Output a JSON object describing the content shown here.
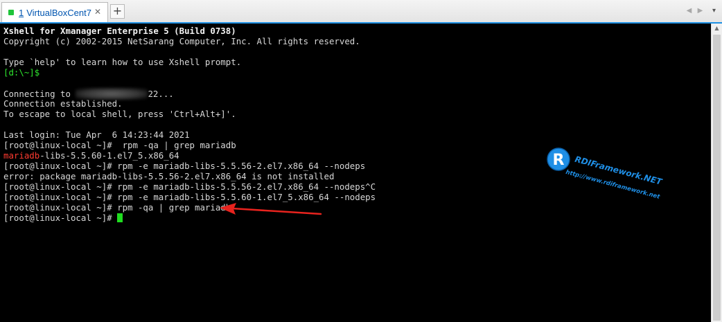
{
  "tabbar": {
    "tab": {
      "number": "1",
      "title": "VirtualBoxCent7",
      "close_glyph": "✕"
    },
    "new_tab_glyph": "+",
    "nav_left_glyph": "◀",
    "nav_right_glyph": "▶",
    "menu_glyph": "▾"
  },
  "colors": {
    "tab_accent": "#1e90e4",
    "terminal_bg": "#000000",
    "prompt_green": "#2ee62e",
    "highlight_red": "#ff3b30",
    "annotation_arrow": "#e8231e"
  },
  "terminal": {
    "banner": "Xshell for Xmanager Enterprise 5 (Build 0738)",
    "copyright": "Copyright (c) 2002-2015 NetSarang Computer, Inc. All rights reserved.",
    "help": "Type `help' to learn how to use Xshell prompt.",
    "local_prompt": "[d:\\~]$",
    "connecting_prefix": "Connecting to ",
    "connecting_suffix": "22...",
    "established": "Connection established.",
    "escape": "To escape to local shell, press 'Ctrl+Alt+]'.",
    "last_login": "Last login: Tue Apr  6 14:23:44 2021",
    "lines": [
      {
        "prompt": "[root@linux-local ~]#",
        "text": "  rpm -qa | grep mariadb"
      },
      {
        "highlight": "mariadb",
        "text": "-libs-5.5.60-1.el7_5.x86_64"
      },
      {
        "prompt": "[root@linux-local ~]#",
        "text": " rpm -e mariadb-libs-5.5.56-2.el7.x86_64 --nodeps"
      },
      {
        "text": "error: package mariadb-libs-5.5.56-2.el7.x86_64 is not installed"
      },
      {
        "prompt": "[root@linux-local ~]#",
        "text": " rpm -e mariadb-libs-5.5.56-2.el7.x86_64 --nodeps^C"
      },
      {
        "prompt": "[root@linux-local ~]#",
        "text": " rpm -e mariadb-libs-5.5.60-1.el7_5.x86_64 --nodeps"
      },
      {
        "prompt": "[root@linux-local ~]#",
        "text": " rpm -qa | grep mariadb"
      },
      {
        "prompt": "[root@linux-local ~]#",
        "text": " "
      }
    ]
  },
  "watermark": {
    "brand": "RDIFramework.NET",
    "url": "http://www.rdiframework.net"
  },
  "scrollbar": {
    "up_glyph": "▲"
  }
}
